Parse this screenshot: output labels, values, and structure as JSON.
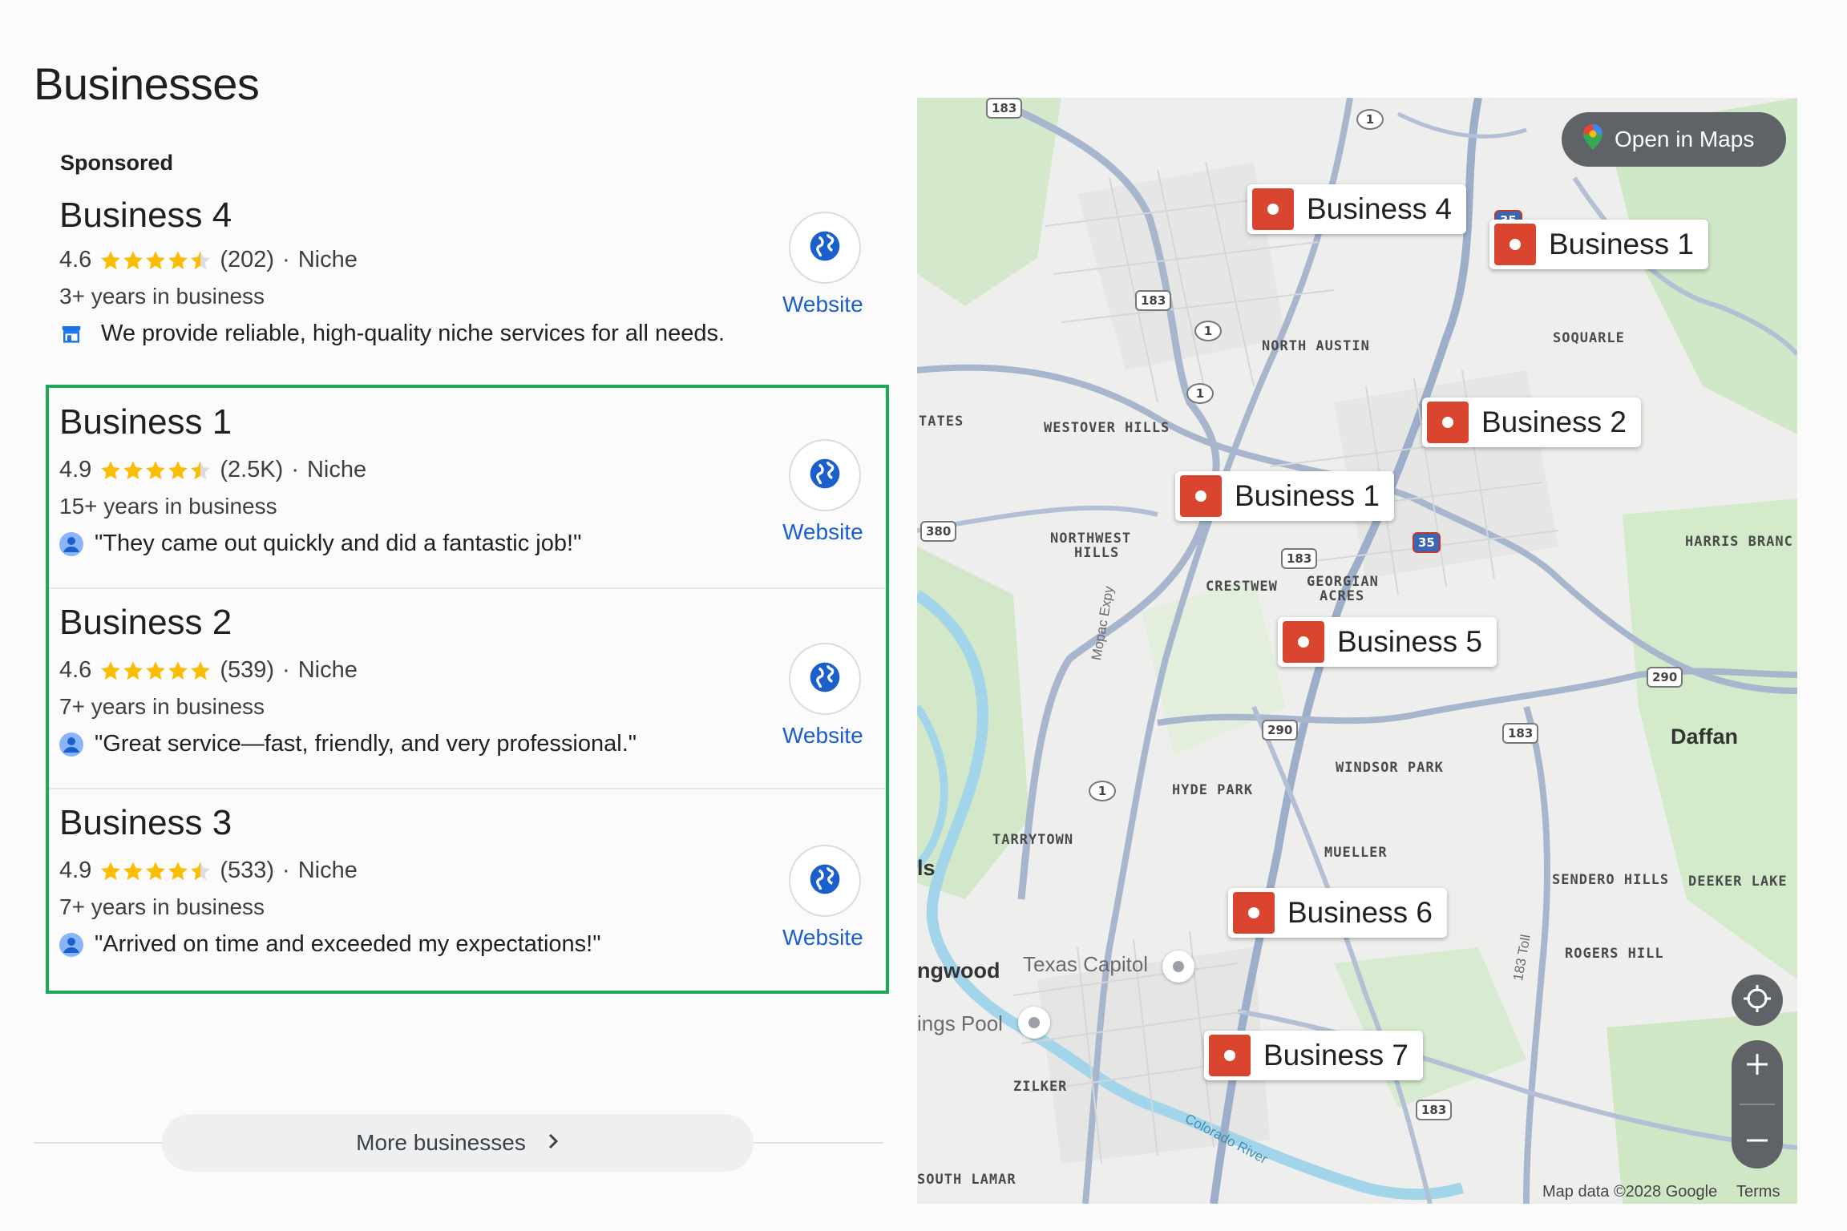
{
  "page_title": "Businesses",
  "sponsored_label": "Sponsored",
  "sponsored": {
    "name": "Business 4",
    "rating": "4.6",
    "stars": 4.5,
    "reviews": "(202)",
    "category": "Niche",
    "years": "3+ years in business",
    "description": "We provide reliable, high-quality niche services for all needs.",
    "website_label": "Website"
  },
  "listings": [
    {
      "name": "Business 1",
      "rating": "4.9",
      "stars": 4.5,
      "reviews": "(2.5K)",
      "category": "Niche",
      "years": "15+ years in business",
      "quote": "\"They came out quickly and did a fantastic job!\"",
      "website_label": "Website"
    },
    {
      "name": "Business 2",
      "rating": "4.6",
      "stars": 5,
      "reviews": "(539)",
      "category": "Niche",
      "years": "7+ years in business",
      "quote": "\"Great service—fast, friendly, and very professional.\"",
      "website_label": "Website"
    },
    {
      "name": "Business 3",
      "rating": "4.9",
      "stars": 4.5,
      "reviews": "(533)",
      "category": "Niche",
      "years": "7+ years in business",
      "quote": "\"Arrived on time and exceeded my expectations!\"",
      "website_label": "Website"
    }
  ],
  "separator": "·",
  "more_button": "More businesses",
  "map": {
    "open_in_maps": "Open in Maps",
    "markers": [
      "Business 4",
      "Business 1",
      "Business 2",
      "Business 1",
      "Business 5",
      "Business 6",
      "Business 7"
    ],
    "place_labels": [
      "NORTH AUSTIN",
      "SOQUARLE",
      "TATES",
      "WESTOVER HILLS",
      "NORTHWEST",
      "HILLS",
      "CRESTWEW",
      "GEORGIAN",
      "ACRES",
      "HARRIS BRANC",
      "Daffan",
      "WINDSOR PARK",
      "HYDE PARK",
      "TARRYTOWN",
      "MUELLER",
      "ls",
      "SENDERO HILLS",
      "DEEKER LAKE",
      "ROGERS HILL",
      "ngwood",
      "Texas Capitol",
      "ings Pool",
      "ZILKER",
      "SOUTH LAMAR",
      "Mopac Expy",
      "183 Toll",
      "Colorado River"
    ],
    "route_shields": [
      "183",
      "1",
      "183",
      "1",
      "1",
      "380",
      "183",
      "35",
      "290",
      "183",
      "290",
      "1",
      "183",
      "35"
    ],
    "attribution": "Map data ©2028 Google",
    "terms": "Terms",
    "colors": {
      "marker": "#d9452f",
      "water": "#9fd3e8",
      "park": "#cfe8c8",
      "road": "#a9b7cf",
      "highlight": "#1ea85a",
      "link": "#1a5fcc"
    }
  }
}
